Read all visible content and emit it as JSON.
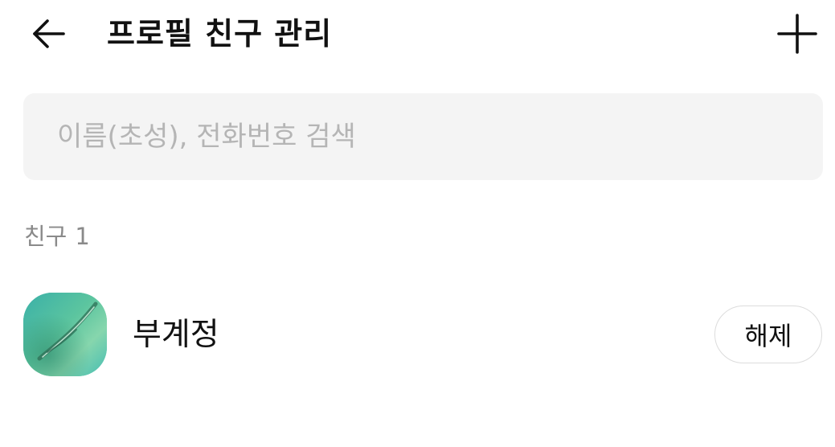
{
  "header": {
    "title": "프로필 친구 관리",
    "back_icon": "arrow-left-icon",
    "add_icon": "plus-icon"
  },
  "search": {
    "placeholder": "이름(초성), 전화번호 검색",
    "value": ""
  },
  "section": {
    "label": "친구",
    "count": "1"
  },
  "friends": [
    {
      "name": "부계정",
      "avatar": "avatar-image",
      "action_label": "해제"
    }
  ],
  "colors": {
    "background": "#ffffff",
    "search_bg": "#f4f4f4",
    "placeholder": "#b5b5b5",
    "section_label": "#8a8a8a",
    "button_border": "#dcdcdc",
    "avatar_accent": "#52c39d"
  }
}
